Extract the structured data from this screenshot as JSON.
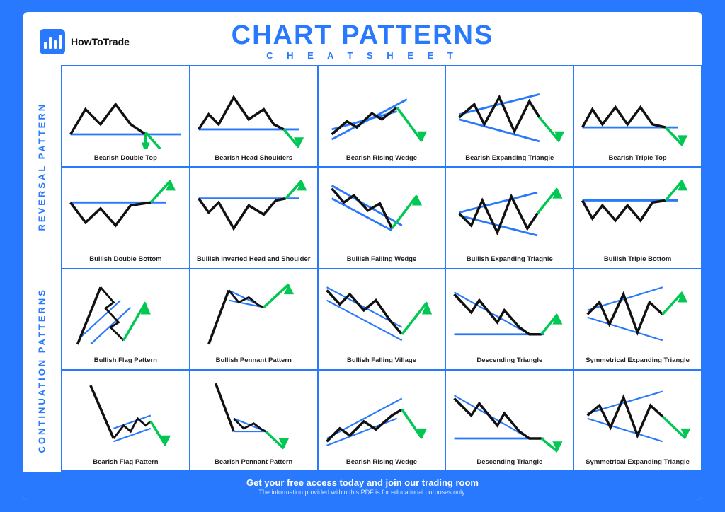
{
  "header": {
    "logo_text": "HowToTrade",
    "main_title": "CHART PATTERNS",
    "sub_title": "C H E A T   S H E E T"
  },
  "side_labels": {
    "reversal": "REVERSAL PATTERN",
    "continuation": "CONTINUATION PATTERNS"
  },
  "cells": [
    {
      "label": "Bearish Double Top",
      "row": 1,
      "col": 1,
      "type": "bearish-double-top"
    },
    {
      "label": "Bearish Head Shoulders",
      "row": 1,
      "col": 2,
      "type": "bearish-head-shoulders"
    },
    {
      "label": "Bearish Rising Wedge",
      "row": 1,
      "col": 3,
      "type": "bearish-rising-wedge"
    },
    {
      "label": "Bearish Expanding Triangle",
      "row": 1,
      "col": 4,
      "type": "bearish-expanding-triangle"
    },
    {
      "label": "Bearish Triple Top",
      "row": 1,
      "col": 5,
      "type": "bearish-triple-top"
    },
    {
      "label": "Bullish Double Bottom",
      "row": 2,
      "col": 1,
      "type": "bullish-double-bottom"
    },
    {
      "label": "Bullish Inverted Head and Shoulder",
      "row": 2,
      "col": 2,
      "type": "bullish-inv-head-shoulders"
    },
    {
      "label": "Bullish Falling Wedge",
      "row": 2,
      "col": 3,
      "type": "bullish-falling-wedge"
    },
    {
      "label": "Bullish Expanding Triagnle",
      "row": 2,
      "col": 4,
      "type": "bullish-expanding-triangle"
    },
    {
      "label": "Bullish Triple Bottom",
      "row": 2,
      "col": 5,
      "type": "bullish-triple-bottom"
    },
    {
      "label": "Bullish Flag Pattern",
      "row": 3,
      "col": 1,
      "type": "bullish-flag"
    },
    {
      "label": "Bullish Pennant Pattern",
      "row": 3,
      "col": 2,
      "type": "bullish-pennant"
    },
    {
      "label": "Bullish Falling Village",
      "row": 3,
      "col": 3,
      "type": "bullish-falling-village"
    },
    {
      "label": "Descending Triangle",
      "row": 3,
      "col": 4,
      "type": "descending-triangle"
    },
    {
      "label": "Symmetrical Expanding Triangle",
      "row": 3,
      "col": 5,
      "type": "sym-expanding-triangle"
    },
    {
      "label": "Bearish Flag Pattern",
      "row": 4,
      "col": 1,
      "type": "bearish-flag"
    },
    {
      "label": "Bearish Pennant Pattern",
      "row": 4,
      "col": 2,
      "type": "bearish-pennant"
    },
    {
      "label": "Bearish Rising Wedge",
      "row": 4,
      "col": 3,
      "type": "bearish-rising-wedge2"
    },
    {
      "label": "Descending Triangle",
      "row": 4,
      "col": 4,
      "type": "descending-triangle2"
    },
    {
      "label": "Symmetrical Expanding Triangle",
      "row": 4,
      "col": 5,
      "type": "sym-expanding-triangle2"
    }
  ],
  "footer": {
    "main": "Get your free access today and join our trading room",
    "sub": "The information provided within this PDF is for educational purposes only."
  }
}
